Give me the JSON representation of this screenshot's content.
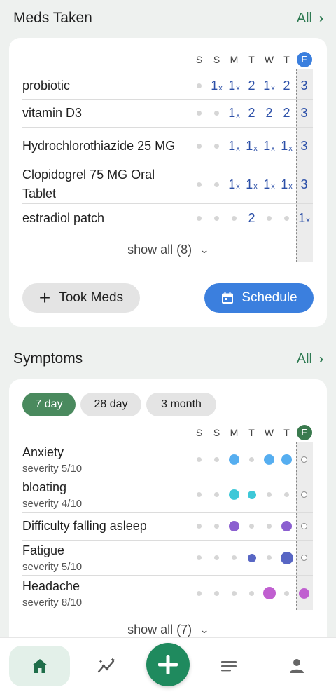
{
  "colors": {
    "background": "#eef1ef",
    "accent_green": "#2e7a52",
    "accent_blue": "#3b7fde",
    "dose_blue": "#2b4fa8",
    "symptom_today": "#3a7a4e",
    "nav_green": "#1f8a5e"
  },
  "meds": {
    "title": "Meds Taken",
    "all_label": "All",
    "days": [
      "S",
      "S",
      "M",
      "T",
      "W",
      "T",
      "F"
    ],
    "rows": [
      {
        "name": "probiotic",
        "cells": [
          "dot",
          "1x",
          "1x",
          "2",
          "1x",
          "2",
          "3"
        ]
      },
      {
        "name": "vitamin D3",
        "cells": [
          "dot",
          "dot",
          "1x",
          "2",
          "2",
          "2",
          "3"
        ]
      },
      {
        "name": "Hydrochlorothiazide 25 MG",
        "cells": [
          "dot",
          "dot",
          "1x",
          "1x",
          "1x",
          "1x",
          "3"
        ]
      },
      {
        "name": "Clopidogrel 75 MG Oral Tablet",
        "cells": [
          "dot",
          "dot",
          "1x",
          "1x",
          "1x",
          "1x",
          "3"
        ]
      },
      {
        "name": "estradiol patch",
        "cells": [
          "dot",
          "dot",
          "dot",
          "2",
          "dot",
          "dot",
          "1x"
        ]
      }
    ],
    "show_all": "show all (8)",
    "took_meds_label": "Took Meds",
    "schedule_label": "Schedule"
  },
  "symptoms": {
    "title": "Symptoms",
    "all_label": "All",
    "ranges": [
      "7 day",
      "28 day",
      "3 month"
    ],
    "selected_range": "7 day",
    "days": [
      "S",
      "S",
      "M",
      "T",
      "W",
      "T",
      "F"
    ],
    "rows": [
      {
        "name": "Anxiety",
        "severity": "severity 5/10",
        "cells": [
          {
            "t": "dot"
          },
          {
            "t": "dot"
          },
          {
            "t": "circle",
            "c": "#56aef0",
            "s": 15
          },
          {
            "t": "dot"
          },
          {
            "t": "circle",
            "c": "#56aef0",
            "s": 15
          },
          {
            "t": "circle",
            "c": "#56aef0",
            "s": 15
          },
          {
            "t": "ring"
          }
        ]
      },
      {
        "name": "bloating",
        "severity": "severity 4/10",
        "cells": [
          {
            "t": "dot"
          },
          {
            "t": "dot"
          },
          {
            "t": "circle",
            "c": "#3ec8d8",
            "s": 15
          },
          {
            "t": "circle",
            "c": "#3ec8d8",
            "s": 12
          },
          {
            "t": "dot"
          },
          {
            "t": "dot"
          },
          {
            "t": "ring"
          }
        ]
      },
      {
        "name": "Difficulty falling asleep",
        "severity": "",
        "cells": [
          {
            "t": "dot"
          },
          {
            "t": "dot"
          },
          {
            "t": "circle",
            "c": "#8b5fd0",
            "s": 15
          },
          {
            "t": "dot"
          },
          {
            "t": "dot"
          },
          {
            "t": "circle",
            "c": "#8b5fd0",
            "s": 15
          },
          {
            "t": "ring"
          }
        ]
      },
      {
        "name": "Fatigue",
        "severity": "severity 5/10",
        "cells": [
          {
            "t": "dot"
          },
          {
            "t": "dot"
          },
          {
            "t": "dot"
          },
          {
            "t": "circle",
            "c": "#5866c4",
            "s": 12
          },
          {
            "t": "dot"
          },
          {
            "t": "circle",
            "c": "#5866c4",
            "s": 18
          },
          {
            "t": "ring"
          }
        ]
      },
      {
        "name": "Headache",
        "severity": "severity 8/10",
        "cells": [
          {
            "t": "dot"
          },
          {
            "t": "dot"
          },
          {
            "t": "dot"
          },
          {
            "t": "dot"
          },
          {
            "t": "circle",
            "c": "#c05fd0",
            "s": 18
          },
          {
            "t": "dot"
          },
          {
            "t": "circle",
            "c": "#c05fd0",
            "s": 15
          }
        ]
      }
    ],
    "show_all": "show all (7)"
  },
  "nav": {
    "items": [
      {
        "icon": "home-icon",
        "active": true
      },
      {
        "icon": "trends-icon",
        "active": false
      },
      {
        "icon": "add-icon",
        "active": false
      },
      {
        "icon": "notes-icon",
        "active": false
      },
      {
        "icon": "profile-icon",
        "active": false
      }
    ]
  }
}
